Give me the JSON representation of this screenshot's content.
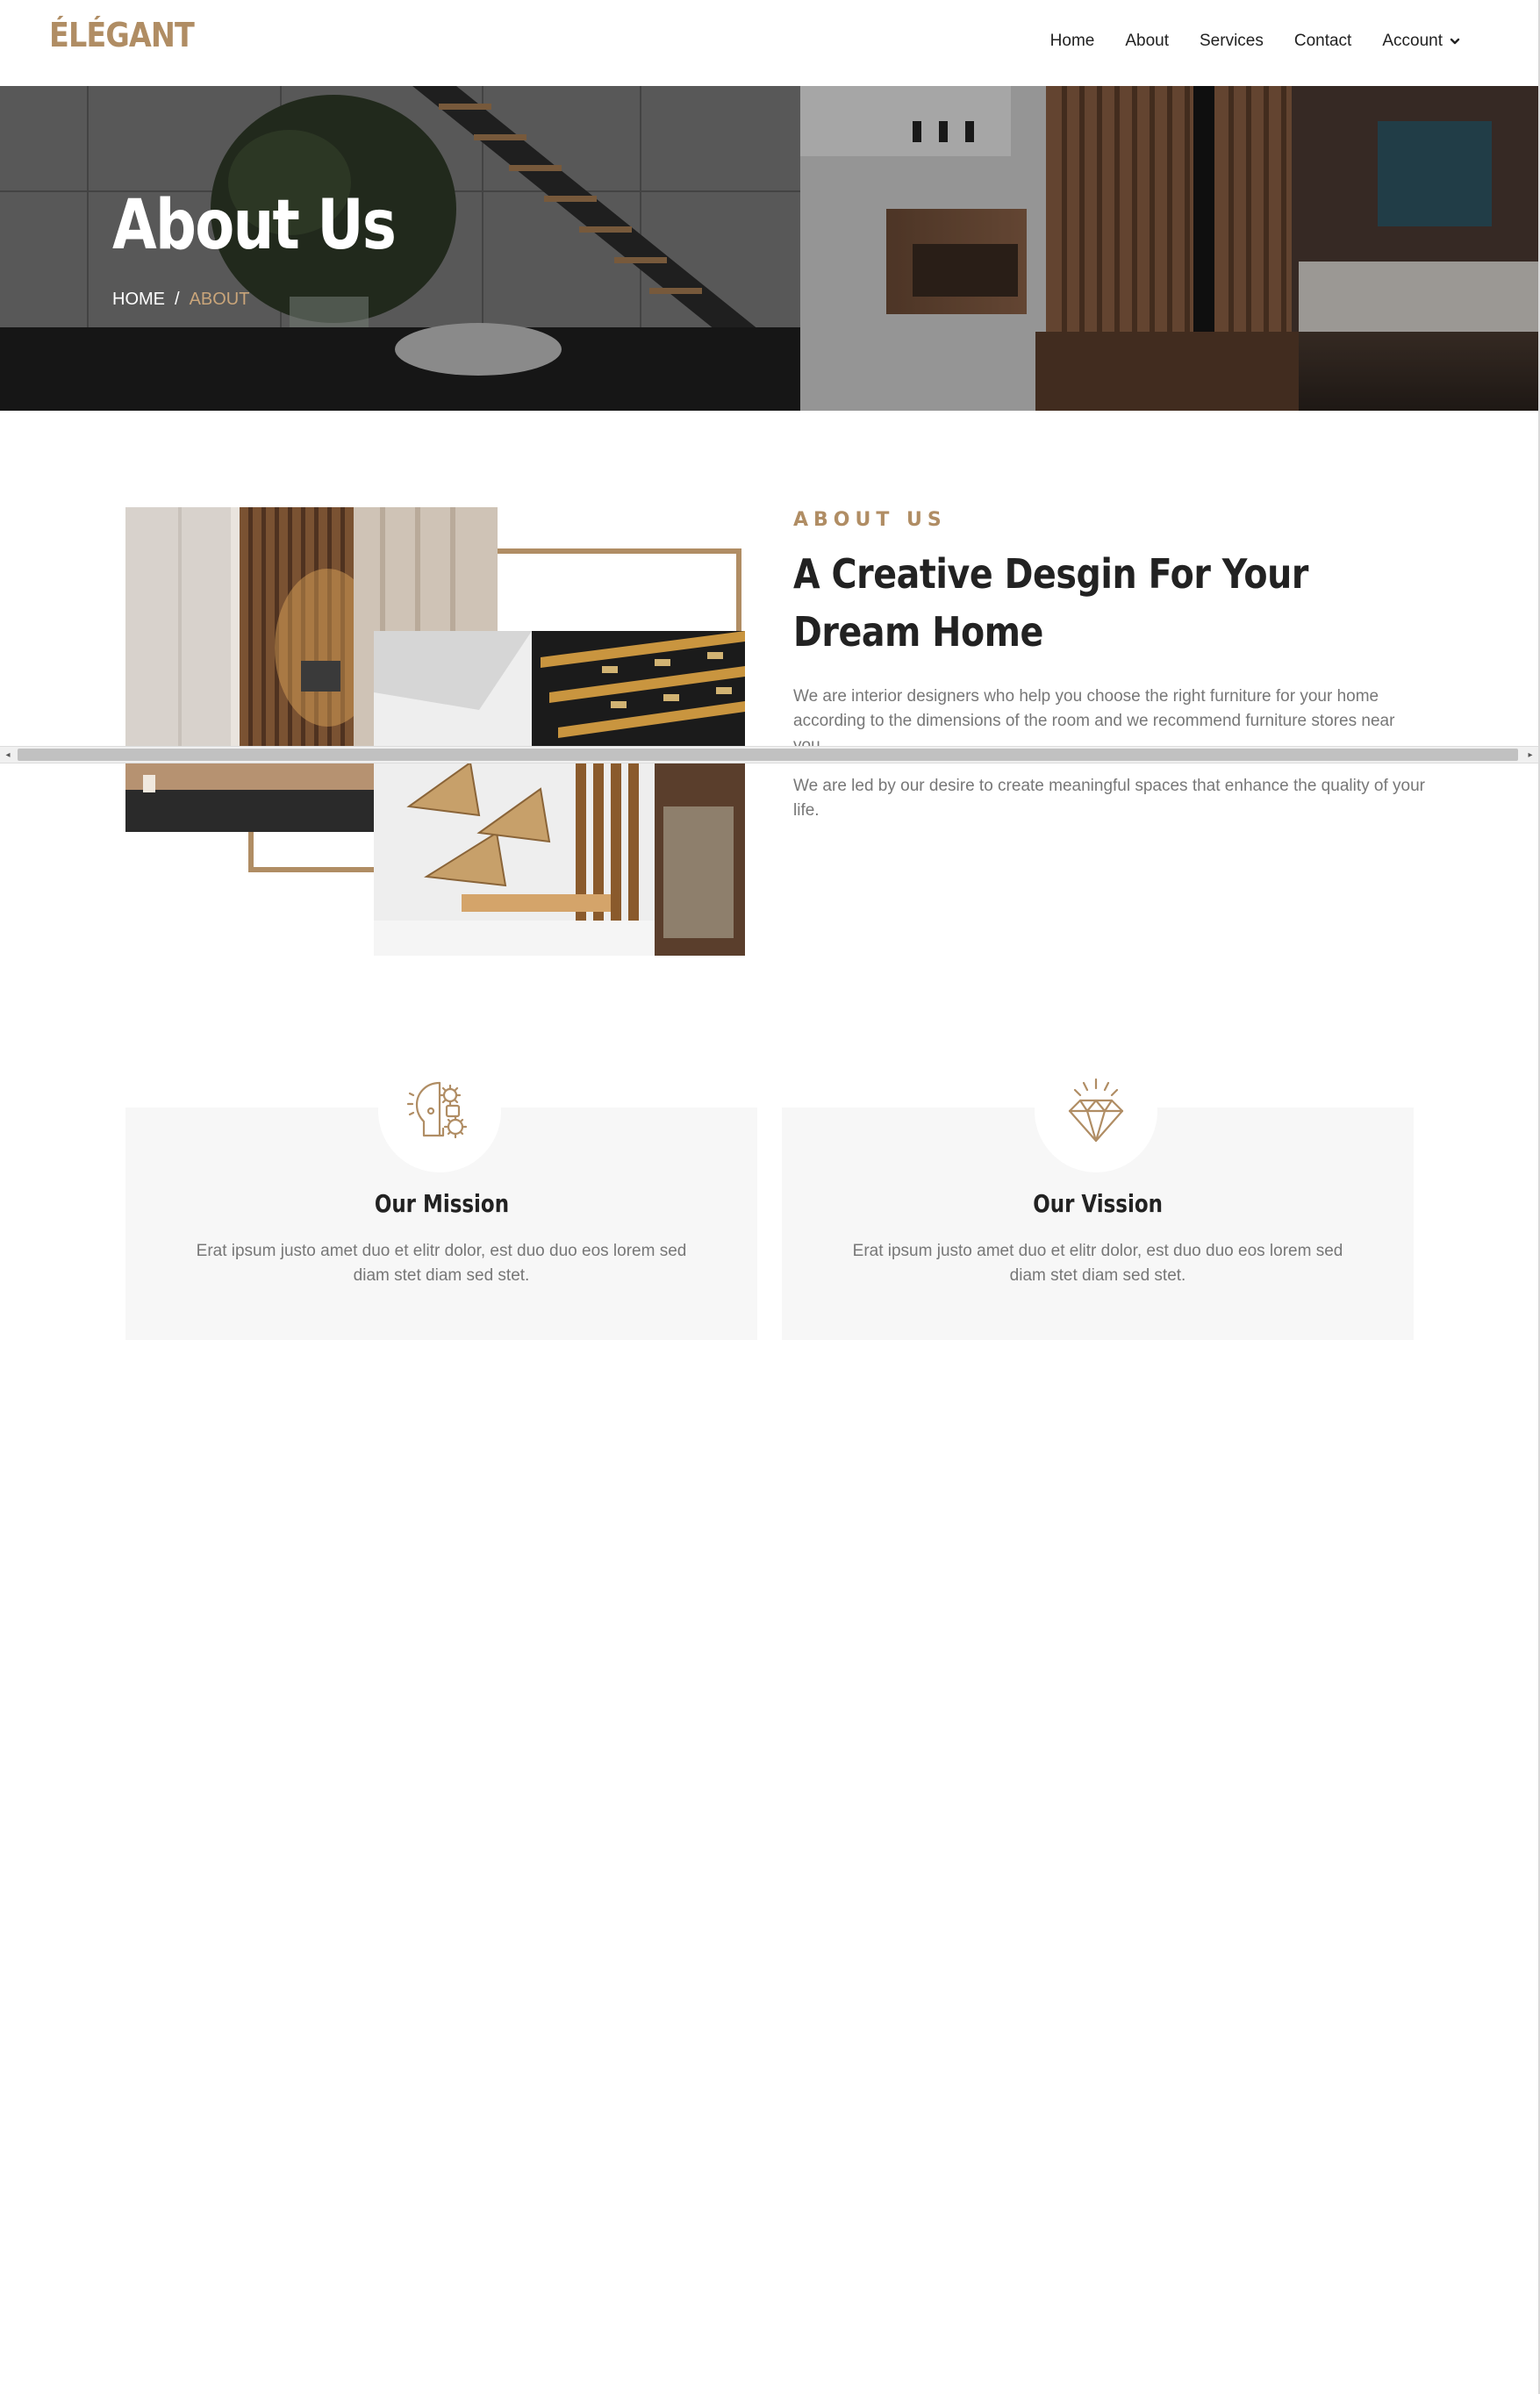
{
  "brand": {
    "logo_text": "ÉLÉGANT",
    "accent_color": "#b08d64"
  },
  "nav": {
    "items": [
      "Home",
      "About",
      "Services",
      "Contact"
    ],
    "account_label": "Account"
  },
  "hero": {
    "title": "About Us",
    "breadcrumb": {
      "home": "HOME",
      "separator": "/",
      "current": "ABOUT"
    }
  },
  "about": {
    "eyebrow": "ABOUT US",
    "headline": "A Creative Desgin For Your Dream Home",
    "paragraph1": "We are interior designers who help you choose the right furniture for your home according to the dimensions of the room and we recommend furniture stores near you.",
    "paragraph2": "We are led by our desire to create meaningful spaces that enhance the quality of your life."
  },
  "cards": [
    {
      "title": "Our Mission",
      "icon": "head-gears-icon",
      "description": "Erat ipsum justo amet duo et elitr dolor, est duo duo eos lorem sed diam stet diam sed stet."
    },
    {
      "title": "Our Vission",
      "icon": "diamond-icon",
      "description": "Erat ipsum justo amet duo et elitr dolor, est duo duo eos lorem sed diam stet diam sed stet."
    }
  ]
}
